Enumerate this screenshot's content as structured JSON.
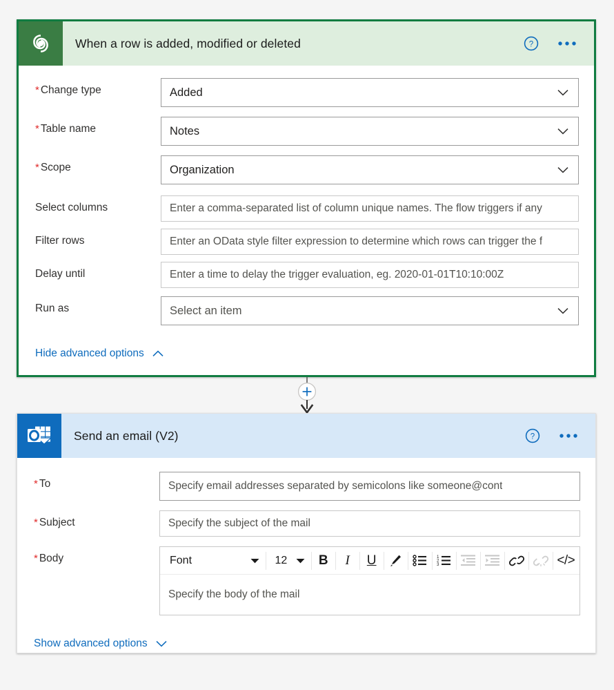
{
  "trigger_card": {
    "icon": "dataverse-icon",
    "title": "When a row is added, modified or deleted",
    "help_icon": "help-circle-icon",
    "menu_icon": "ellipsis-icon",
    "accent_color": "#107c41",
    "header_background": "#deeede",
    "fields": [
      {
        "label": "Change type",
        "required": true,
        "value": "Added",
        "type": "dropdown"
      },
      {
        "label": "Table name",
        "required": true,
        "value": "Notes",
        "type": "dropdown"
      },
      {
        "label": "Scope",
        "required": true,
        "value": "Organization",
        "type": "dropdown"
      },
      {
        "label": "Select columns",
        "required": false,
        "placeholder": "Enter a comma-separated list of column unique names. The flow triggers if any",
        "type": "text"
      },
      {
        "label": "Filter rows",
        "required": false,
        "placeholder": "Enter an OData style filter expression to determine which rows can trigger the f",
        "type": "text"
      },
      {
        "label": "Delay until",
        "required": false,
        "placeholder": "Enter a time to delay the trigger evaluation, eg. 2020-01-01T10:10:00Z",
        "type": "text"
      },
      {
        "label": "Run as",
        "required": false,
        "value": "Select an item",
        "type": "dropdown"
      }
    ],
    "advanced_options": {
      "label": "Hide advanced options",
      "icon": "chevron-up-icon"
    }
  },
  "connector": {
    "add_button_icon": "plus-icon",
    "arrow_icon": "arrow-down-icon",
    "plus_color": "#0f6cbd"
  },
  "action_card": {
    "icon": "outlook-icon",
    "title": "Send an email (V2)",
    "help_icon": "help-circle-icon",
    "menu_icon": "ellipsis-icon",
    "header_background": "#d7e8f8",
    "fields": [
      {
        "label": "To",
        "required": true,
        "placeholder": "Specify email addresses separated by semicolons like someone@cont"
      },
      {
        "label": "Subject",
        "required": true,
        "placeholder": "Specify the subject of the mail"
      },
      {
        "label": "Body",
        "required": true,
        "placeholder": "Specify the body of the mail"
      }
    ],
    "editor_toolbar": {
      "font_name": "Font",
      "font_size": "12",
      "buttons": [
        {
          "name": "bold-button",
          "glyph": "B",
          "enabled": true
        },
        {
          "name": "italic-button",
          "glyph": "I",
          "enabled": true
        },
        {
          "name": "underline-button",
          "glyph": "U",
          "enabled": true
        },
        {
          "name": "text-highlight-button",
          "glyph": "pen-icon",
          "enabled": true
        },
        {
          "name": "bulleted-list-button",
          "glyph": "bullet-list-icon",
          "enabled": true
        },
        {
          "name": "numbered-list-button",
          "glyph": "numbered-list-icon",
          "enabled": true
        },
        {
          "name": "decrease-indent-button",
          "glyph": "outdent-icon",
          "enabled": false
        },
        {
          "name": "increase-indent-button",
          "glyph": "indent-icon",
          "enabled": false
        },
        {
          "name": "insert-link-button",
          "glyph": "link-icon",
          "enabled": true
        },
        {
          "name": "remove-link-button",
          "glyph": "unlink-icon",
          "enabled": false
        },
        {
          "name": "code-view-button",
          "glyph": "</>",
          "enabled": true
        }
      ]
    },
    "advanced_options": {
      "label": "Show advanced options",
      "icon": "chevron-down-icon"
    }
  }
}
